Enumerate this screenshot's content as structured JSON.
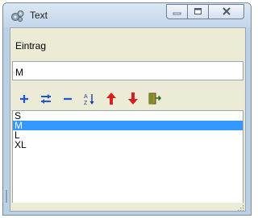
{
  "window": {
    "title": "Text",
    "icon": "gears-icon",
    "controls": [
      "minimize-icon",
      "maximize-icon",
      "close-icon"
    ]
  },
  "entry": {
    "label": "Eintrag",
    "value": "M"
  },
  "toolbar": {
    "buttons": [
      {
        "name": "add",
        "icon": "plus-icon",
        "color": "#1f55d6"
      },
      {
        "name": "edit",
        "icon": "swap-icon",
        "color": "#1f55d6"
      },
      {
        "name": "remove",
        "icon": "minus-icon",
        "color": "#1f55d6"
      },
      {
        "name": "sort",
        "icon": "sort-az-icon",
        "color": "#1f55d6"
      },
      {
        "name": "move-up",
        "icon": "arrow-up-icon",
        "color": "#d91e1e"
      },
      {
        "name": "move-down",
        "icon": "arrow-down-icon",
        "color": "#d91e1e"
      },
      {
        "name": "exit",
        "icon": "exit-door-icon",
        "color": "#7a8f2a"
      }
    ]
  },
  "list": {
    "items": [
      "S",
      "M",
      "L",
      "XL"
    ],
    "selected": "M"
  },
  "colors": {
    "selection": "#3399ff",
    "panel": "#ecebd6",
    "frame": "#bcd1e6"
  }
}
